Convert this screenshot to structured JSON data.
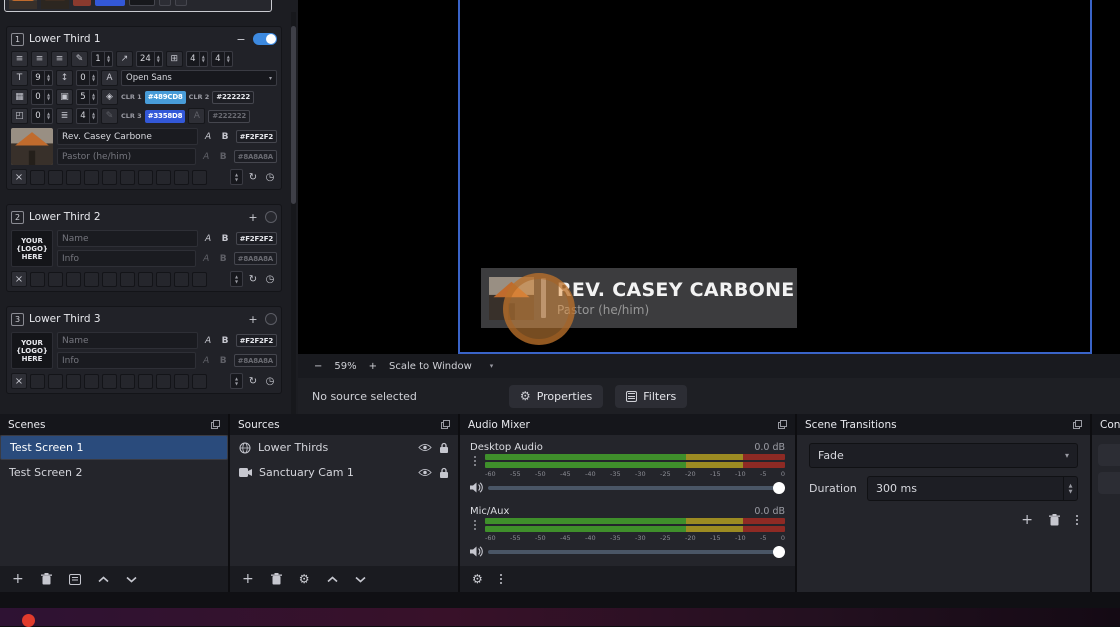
{
  "left_dock": {
    "sections": [
      {
        "index": "1",
        "title": "Lower Third 1",
        "collapse_glyph": "−",
        "spin_a": "1",
        "spin_b": "24",
        "spin_c": "4",
        "spin_d": "4",
        "text_size": "9",
        "line_offset": "0",
        "font_name": "Open Sans",
        "img_spin": "0",
        "copy_spin": "5",
        "clr1_label": "CLR 1",
        "clr1_hex": "#489CD8",
        "clr2_label": "CLR 2",
        "clr2_hex": "#222222",
        "corner_spin": "0",
        "border_spin": "4",
        "clr3_label": "CLR 3",
        "clr3_hex": "#3358D8",
        "clr4_hex": "#222222",
        "name_value": "Rev. Casey Carbone",
        "name_color": "#F2F2F2",
        "info_value": "Pastor (he/him)",
        "info_color": "#8A8A8A"
      },
      {
        "index": "2",
        "title": "Lower Third 2",
        "add_glyph": "+",
        "logo_line1": "YOUR",
        "logo_line2": "{LOGO}",
        "logo_line3": "HERE",
        "name_placeholder": "Name",
        "name_color": "#F2F2F2",
        "info_placeholder": "Info",
        "info_color": "#8A8A8A"
      },
      {
        "index": "3",
        "title": "Lower Third 3",
        "add_glyph": "+",
        "logo_line1": "YOUR",
        "logo_line2": "{LOGO}",
        "logo_line3": "HERE",
        "name_placeholder": "Name",
        "name_color": "#F2F2F2",
        "info_placeholder": "Info",
        "info_color": "#8A8A8A"
      }
    ]
  },
  "preview": {
    "lower_third_name": "REV. CASEY CARBONE",
    "lower_third_role": "Pastor (he/him)",
    "zoom_out": "−",
    "zoom_level": "59%",
    "zoom_in": "+",
    "scale_mode": "Scale to Window",
    "status_text": "No source selected",
    "properties_label": "Properties",
    "filters_label": "Filters"
  },
  "docks": {
    "scenes": {
      "title": "Scenes",
      "items": [
        {
          "label": "Test Screen 1"
        },
        {
          "label": "Test Screen 2"
        }
      ]
    },
    "sources": {
      "title": "Sources",
      "items": [
        {
          "label": "Lower Thirds"
        },
        {
          "label": "Sanctuary Cam 1"
        }
      ]
    },
    "audio_mixer": {
      "title": "Audio Mixer",
      "channels": [
        {
          "label": "Desktop Audio",
          "level": "0.0 dB"
        },
        {
          "label": "Mic/Aux",
          "level": "0.0 dB"
        }
      ],
      "scale": [
        "-60",
        "-55",
        "-50",
        "-45",
        "-40",
        "-35",
        "-30",
        "-25",
        "-20",
        "-15",
        "-10",
        "-5",
        "0"
      ]
    },
    "transitions": {
      "title": "Scene Transitions",
      "selected": "Fade",
      "duration_label": "Duration",
      "duration_value": "300 ms"
    },
    "controls": {
      "title": "Con"
    }
  },
  "colors": {
    "accent_blue": "#3d8ae0",
    "selection_blue": "#2a4b7c",
    "canvas_border": "#3a64c8",
    "clr1": "#489CD8",
    "clr3": "#3358D8",
    "meter_green": "#3f8f2b",
    "meter_yellow": "#9c8b22",
    "meter_red": "#8e2a24"
  }
}
